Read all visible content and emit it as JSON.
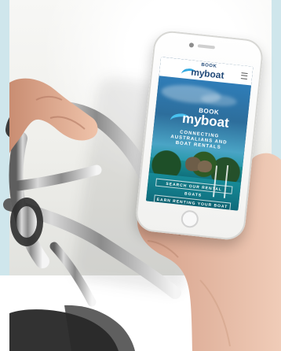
{
  "image": {
    "description_colors": {
      "deck": "#efefeb",
      "frame": "#cfe6ec",
      "phone_blue": "#1a4d75",
      "logo_blue": "#234b7a",
      "accent_blue": "#33a9e0"
    }
  },
  "phone_ui": {
    "top_bar": {
      "logo_top": "BOOK",
      "logo_word_1": "my",
      "logo_word_2": "boat",
      "menu_icon": "hamburger-menu-icon"
    },
    "hero": {
      "logo_top": "BOOK",
      "logo_word_1": "my",
      "logo_word_2": "boat",
      "tagline": "CONNECTING AUSTRALIANS AND BOAT RENTALS",
      "search_button": "SEARCH OUR RENTAL BOATS",
      "earn_button": "EARN RENTING YOUR BOAT"
    }
  }
}
